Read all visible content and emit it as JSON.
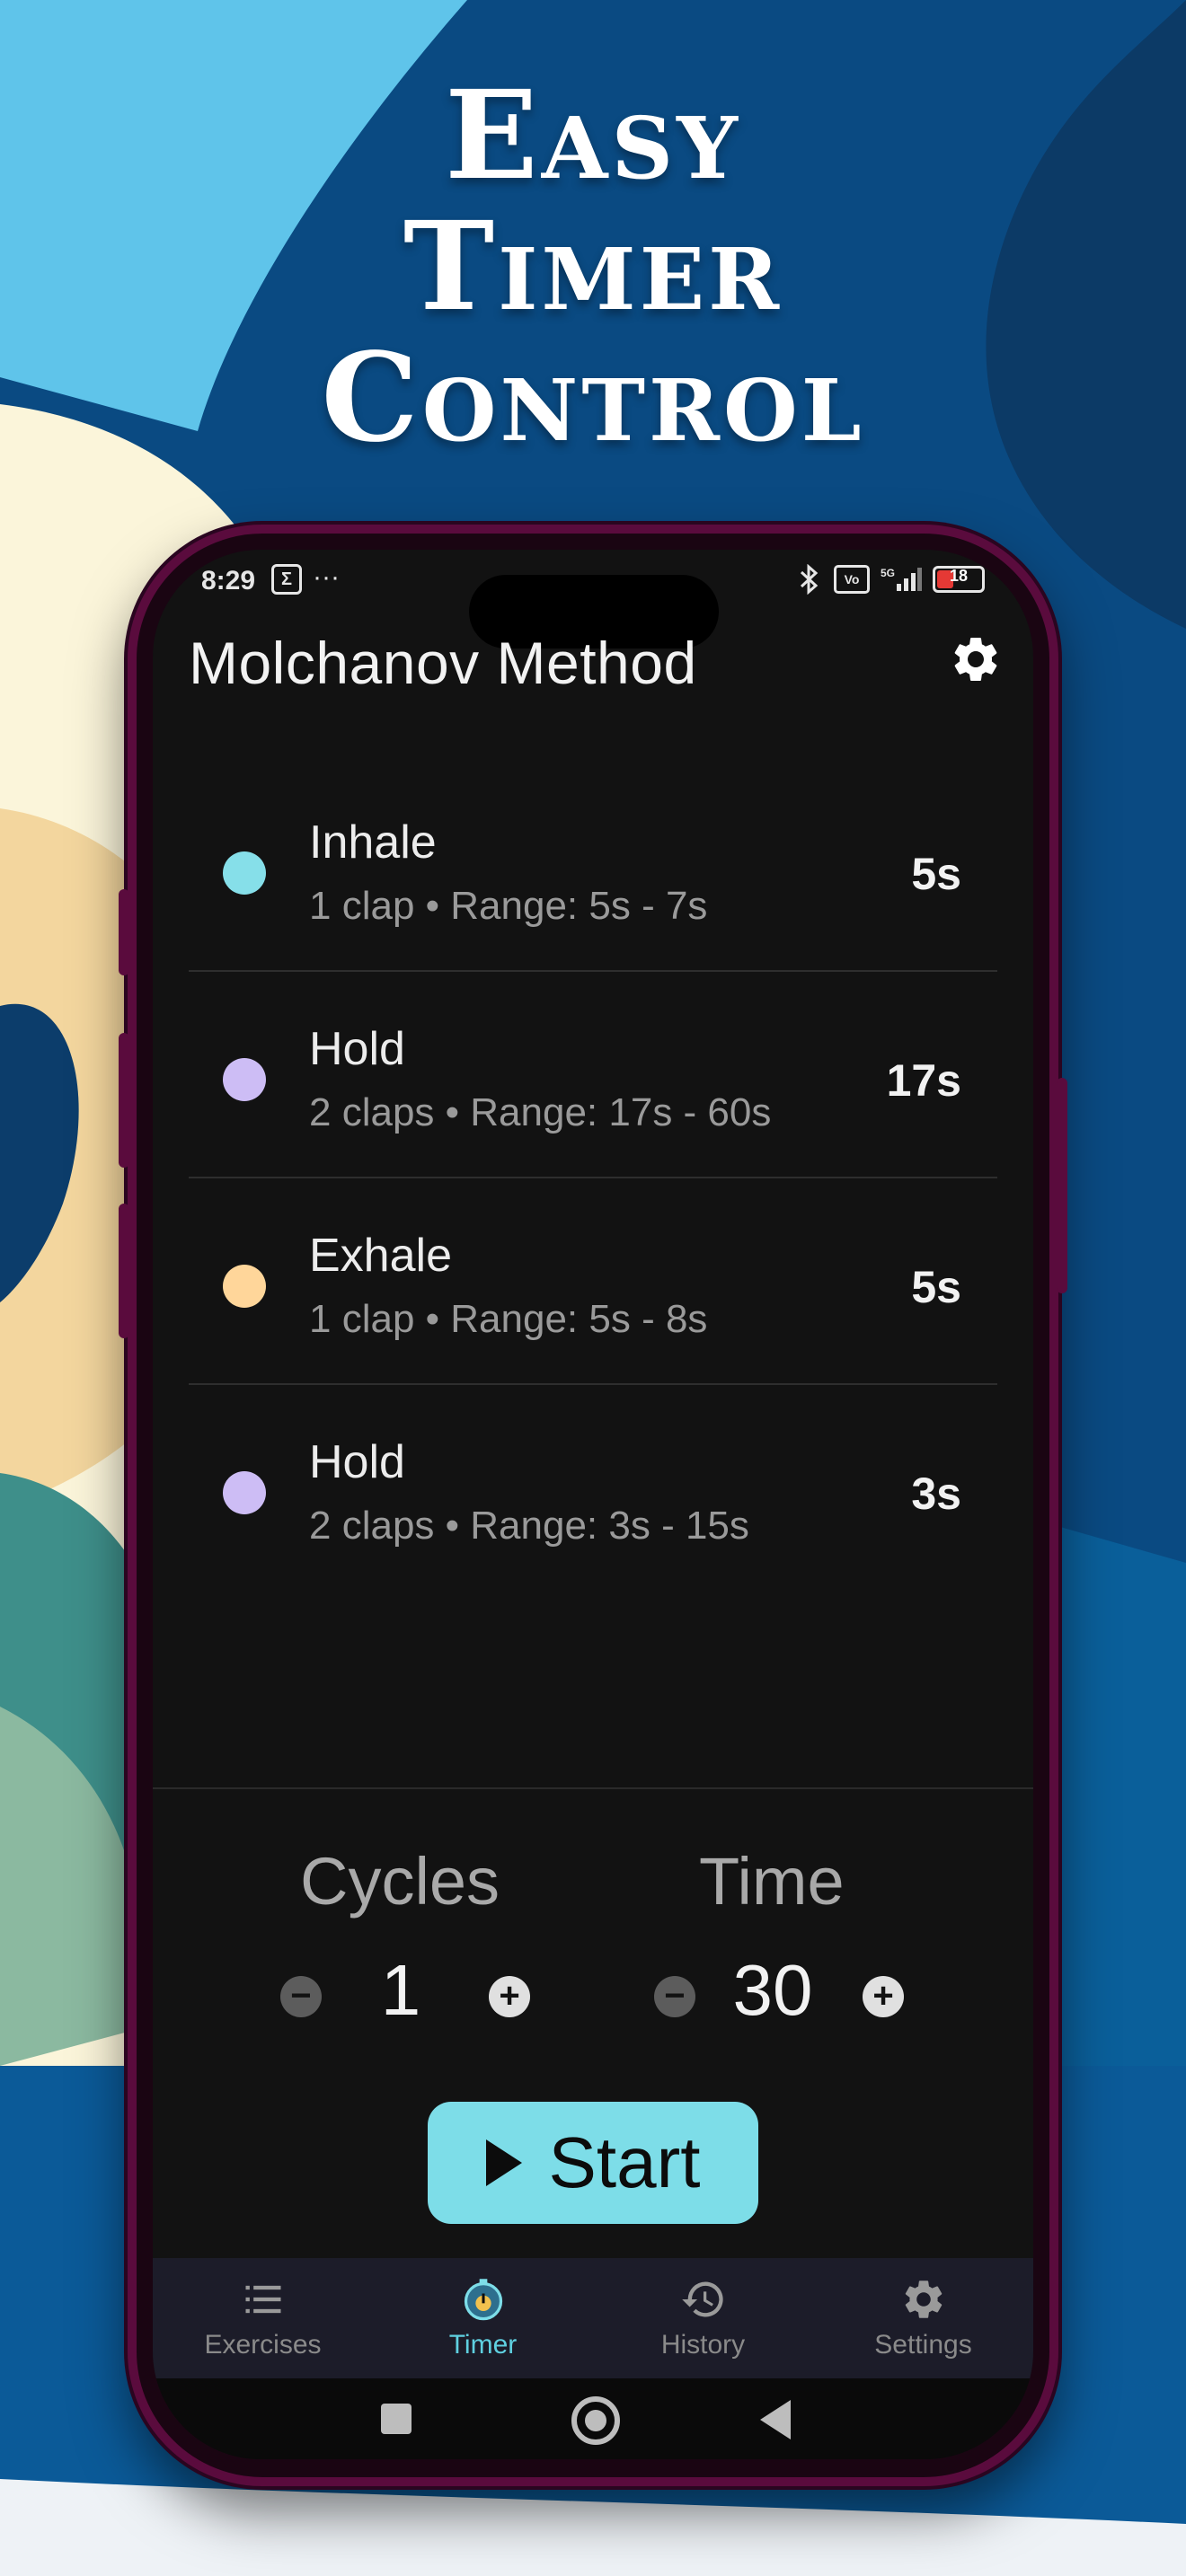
{
  "headline": {
    "line1": "Easy",
    "line2": "Timer",
    "line3": "Control"
  },
  "status_bar": {
    "time": "8:29",
    "sigma": "Σ",
    "dots": "···",
    "battery": "18",
    "net": "5G"
  },
  "app": {
    "title": "Molchanov Method"
  },
  "phases": [
    {
      "name": "Inhale",
      "detail": "1 clap • Range: 5s - 7s",
      "value": "5s",
      "color": "#86dfe9"
    },
    {
      "name": "Hold",
      "detail": "2 claps • Range: 17s - 60s",
      "value": "17s",
      "color": "#cdbdf5"
    },
    {
      "name": "Exhale",
      "detail": "1 clap • Range: 5s - 8s",
      "value": "5s",
      "color": "#ffd69a"
    },
    {
      "name": "Hold",
      "detail": "2 claps • Range: 3s - 15s",
      "value": "3s",
      "color": "#cdbdf5"
    }
  ],
  "controls": {
    "cycles_label": "Cycles",
    "cycles_value": "1",
    "time_label": "Time",
    "time_value": "30",
    "minus": "−",
    "plus": "+"
  },
  "start": {
    "label": "Start"
  },
  "nav": {
    "items": [
      {
        "label": "Exercises",
        "icon": "list-icon"
      },
      {
        "label": "Timer",
        "icon": "timer-icon",
        "active": true
      },
      {
        "label": "History",
        "icon": "history-icon"
      },
      {
        "label": "Settings",
        "icon": "gear-icon"
      }
    ]
  },
  "colors": {
    "accent": "#7ddde8",
    "screen": "#121212",
    "frame": "#5a0b3d"
  }
}
